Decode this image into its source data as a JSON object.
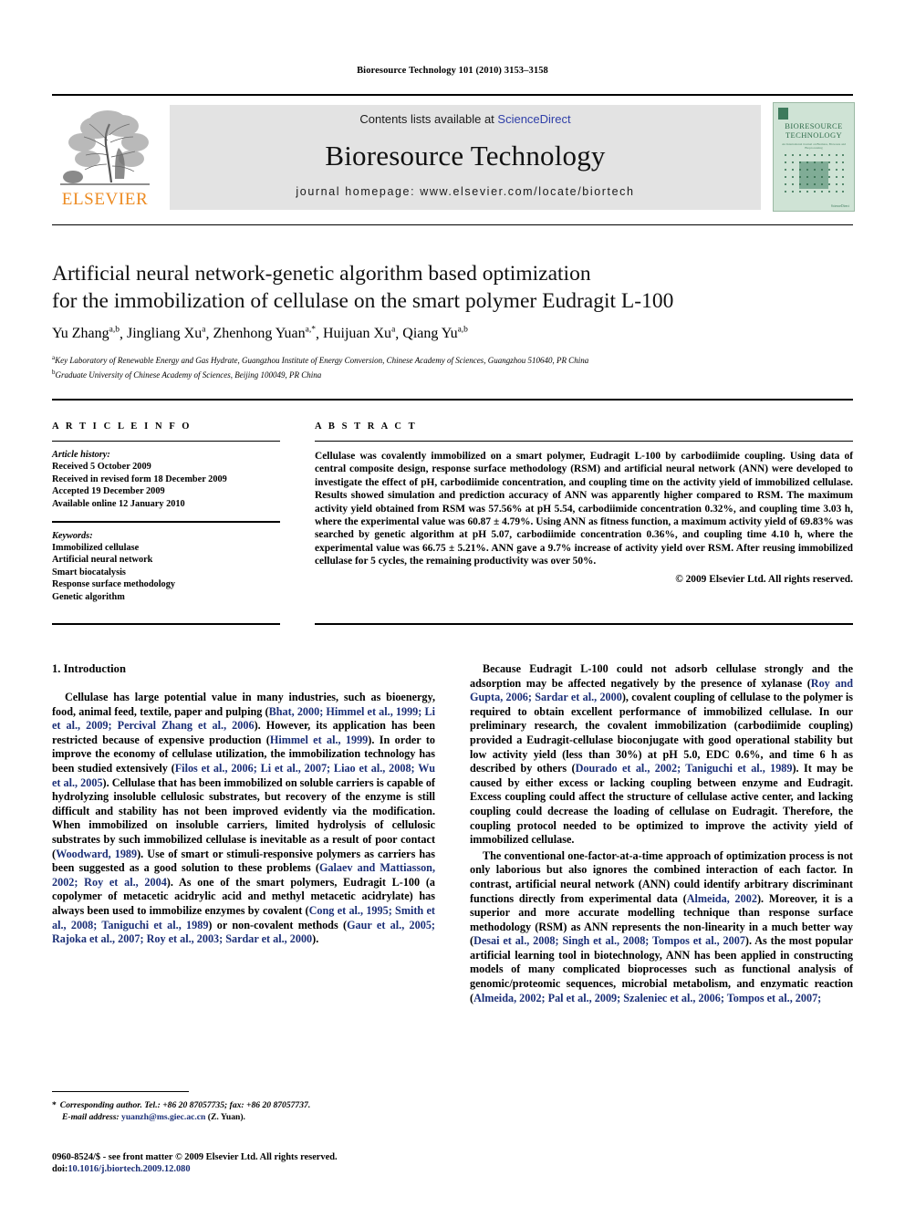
{
  "running_head": "Bioresource Technology 101 (2010) 3153–3158",
  "masthead": {
    "contents_prefix": "Contents lists available at ",
    "sciencedirect": "ScienceDirect",
    "journal_name": "Bioresource Technology",
    "homepage": "journal homepage: www.elsevier.com/locate/biortech",
    "publisher_logo_text": "ELSEVIER",
    "cover": {
      "title": "BIORESOURCE TECHNOLOGY",
      "subtitle": "An International Journal on Biomass, Biowaste and Bioprocessing",
      "footer": "ScienceDirect"
    },
    "colors": {
      "link": "#2f3fa8",
      "elsevier_orange": "#ED8B22",
      "banner_gray": "#e3e3e3",
      "cover_green": "#cfe3d5",
      "citation_blue": "#1b2f77"
    }
  },
  "article": {
    "title_line1": "Artificial neural network-genetic algorithm based optimization",
    "title_line2": "for the immobilization of cellulase on the smart polymer Eudragit L-100",
    "authors": [
      {
        "name": "Yu Zhang",
        "sup": "a,b"
      },
      {
        "name": "Jingliang Xu",
        "sup": "a"
      },
      {
        "name": "Zhenhong Yuan",
        "sup": "a,*"
      },
      {
        "name": "Huijuan Xu",
        "sup": "a"
      },
      {
        "name": "Qiang Yu",
        "sup": "a,b"
      }
    ],
    "affiliations": [
      {
        "sup": "a",
        "text": "Key Laboratory of Renewable Energy and Gas Hydrate, Guangzhou Institute of Energy Conversion, Chinese Academy of Sciences, Guangzhou 510640, PR China"
      },
      {
        "sup": "b",
        "text": "Graduate University of Chinese Academy of Sciences, Beijing 100049, PR China"
      }
    ]
  },
  "article_info": {
    "heading": "A R T I C L E    I N F O",
    "history_label": "Article history:",
    "history": [
      "Received 5 October 2009",
      "Received in revised form 18 December 2009",
      "Accepted 19 December 2009",
      "Available online 12 January 2010"
    ],
    "keywords_label": "Keywords:",
    "keywords": [
      "Immobilized cellulase",
      "Artificial neural network",
      "Smart biocatalysis",
      "Response surface methodology",
      "Genetic algorithm"
    ]
  },
  "abstract": {
    "heading": "A B S T R A C T",
    "text": "Cellulase was covalently immobilized on a smart polymer, Eudragit L-100 by carbodiimide coupling. Using data of central composite design, response surface methodology (RSM) and artificial neural network (ANN) were developed to investigate the effect of pH, carbodiimide concentration, and coupling time on the activity yield of immobilized cellulase. Results showed simulation and prediction accuracy of ANN was apparently higher compared to RSM. The maximum activity yield obtained from RSM was 57.56% at pH 5.54, carbodiimide concentration 0.32%, and coupling time 3.03 h, where the experimental value was 60.87 ± 4.79%. Using ANN as fitness function, a maximum activity yield of 69.83% was searched by genetic algorithm at pH 5.07, carbodiimide concentration 0.36%, and coupling time 4.10 h, where the experimental value was 66.75 ± 5.21%. ANN gave a 9.7% increase of activity yield over RSM. After reusing immobilized cellulase for 5 cycles, the remaining productivity was over 50%.",
    "copyright": "© 2009 Elsevier Ltd. All rights reserved."
  },
  "body": {
    "section_title": "1. Introduction",
    "left_paragraphs": [
      "Cellulase has large potential value in many industries, such as bioenergy, food, animal feed, textile, paper and pulping (Bhat, 2000; Himmel et al., 1999; Li et al., 2009; Percival Zhang et al., 2006). However, its application has been restricted because of expensive production (Himmel et al., 1999). In order to improve the economy of cellulase utilization, the immobilization technology has been studied extensively (Filos et al., 2006; Li et al., 2007; Liao et al., 2008; Wu et al., 2005). Cellulase that has been immobilized on soluble carriers is capable of hydrolyzing insoluble cellulosic substrates, but recovery of the enzyme is still difficult and stability has not been improved evidently via the modification. When immobilized on insoluble carriers, limited hydrolysis of cellulosic substrates by such immobilized cellulase is inevitable as a result of poor contact (Woodward, 1989). Use of smart or stimuli-responsive polymers as carriers has been suggested as a good solution to these problems (Galaev and Mattiasson, 2002; Roy et al., 2004). As one of the smart polymers, Eudragit L-100 (a copolymer of metacetic acidrylic acid and methyl metacetic acidrylate) has always been used to immobilize enzymes by covalent (Cong et al., 1995; Smith et al., 2008; Taniguchi et al., 1989) or non-covalent methods (Gaur et al., 2005; Rajoka et al., 2007; Roy et al., 2003; Sardar et al., 2000)."
    ],
    "right_paragraphs": [
      "Because Eudragit L-100 could not adsorb cellulase strongly and the adsorption may be affected negatively by the presence of xylanase (Roy and Gupta, 2006; Sardar et al., 2000), covalent coupling of cellulase to the polymer is required to obtain excellent performance of immobilized cellulase. In our preliminary research, the covalent immobilization (carbodiimide coupling) provided a Eudragit-cellulase bioconjugate with good operational stability but low activity yield (less than 30%) at pH 5.0, EDC 0.6%, and time 6 h as described by others (Dourado et al., 2002; Taniguchi et al., 1989). It may be caused by either excess or lacking coupling between enzyme and Eudragit. Excess coupling could affect the structure of cellulase active center, and lacking coupling could decrease the loading of cellulase on Eudragit. Therefore, the coupling protocol needed to be optimized to improve the activity yield of immobilized cellulase.",
      "The conventional one-factor-at-a-time approach of optimization process is not only laborious but also ignores the combined interaction of each factor. In contrast, artificial neural network (ANN) could identify arbitrary discriminant functions directly from experimental data (Almeida, 2002). Moreover, it is a superior and more accurate modelling technique than response surface methodology (RSM) as ANN represents the non-linearity in a much better way (Desai et al., 2008; Singh et al., 2008; Tompos et al., 2007). As the most popular artificial learning tool in biotechnology, ANN has been applied in constructing models of many complicated bioprocesses such as functional analysis of genomic/proteomic sequences, microbial metabolism, and enzymatic reaction (Almeida, 2002; Pal et al., 2009; Szaleniec et al., 2006; Tompos et al., 2007;"
    ]
  },
  "footnotes": {
    "corresponding": "Corresponding author. Tel.: +86 20 87057735; fax: +86 20 87057737.",
    "email_label": "E-mail address:",
    "email": "yuanzh@ms.giec.ac.cn",
    "email_owner": "(Z. Yuan).",
    "issn_line": "0960-8524/$ - see front matter © 2009 Elsevier Ltd. All rights reserved.",
    "doi_label": "doi:",
    "doi": "10.1016/j.biortech.2009.12.080"
  }
}
